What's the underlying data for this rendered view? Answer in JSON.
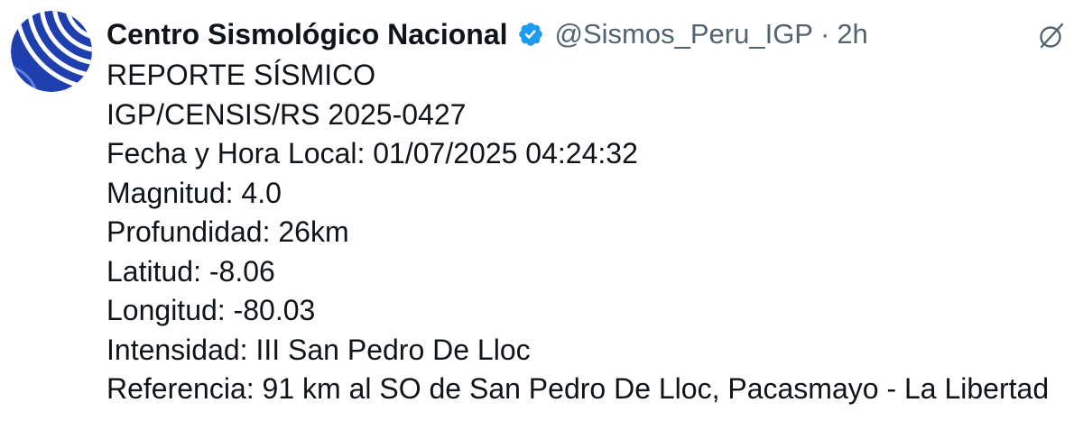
{
  "tweet": {
    "author_name": "Centro Sismológico Nacional",
    "verified": true,
    "handle": "@Sismos_Peru_IGP",
    "separator": "·",
    "time": "2h",
    "lines": [
      "REPORTE SÍSMICO",
      "IGP/CENSIS/RS 2025-0427",
      "Fecha y Hora Local: 01/07/2025 04:24:32",
      "Magnitud: 4.0",
      "Profundidad: 26km",
      "Latitud: -8.06",
      "Longitud: -80.03",
      "Intensidad: III San Pedro De Lloc",
      "Referencia: 91 km al SO de San Pedro De Lloc, Pacasmayo - La Libertad"
    ]
  },
  "icons": {
    "avatar": "igp-logo-avatar",
    "verified": "verified-badge-icon",
    "top_right": "grok-icon"
  },
  "colors": {
    "text": "#0f1419",
    "secondary": "#536471",
    "verified": "#1d9bf0",
    "avatar_bg": "#1f3fae",
    "avatar_lines": "#ffffff"
  }
}
